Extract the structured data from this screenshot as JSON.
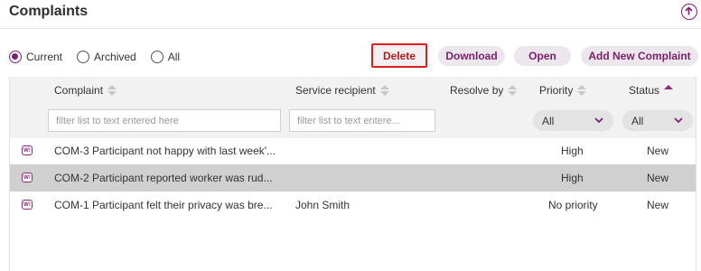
{
  "header": {
    "title": "Complaints",
    "upload_icon": "upload-icon"
  },
  "filters": {
    "radios": [
      {
        "label": "Current",
        "checked": true
      },
      {
        "label": "Archived",
        "checked": false
      },
      {
        "label": "All",
        "checked": false
      }
    ]
  },
  "actions": {
    "delete": "Delete",
    "download": "Download",
    "open": "Open",
    "add": "Add New Complaint"
  },
  "table": {
    "columns": {
      "complaint": "Complaint",
      "service_recipient": "Service recipient",
      "resolve_by": "Resolve by",
      "priority": "Priority",
      "status": "Status"
    },
    "filter_placeholders": {
      "complaint": "filter list to text entered here",
      "service_recipient": "filter list to text entere..."
    },
    "select_values": {
      "priority": "All",
      "status": "All"
    },
    "rows": [
      {
        "complaint": "COM-3 Participant not happy with last week'...",
        "service_recipient": "",
        "resolve_by": "",
        "priority": "High",
        "status": "New",
        "selected": false
      },
      {
        "complaint": "COM-2 Participant reported worker was rud...",
        "service_recipient": "",
        "resolve_by": "",
        "priority": "High",
        "status": "New",
        "selected": true
      },
      {
        "complaint": "COM-1 Participant felt their privacy was bre...",
        "service_recipient": "John Smith",
        "resolve_by": "",
        "priority": "No priority",
        "status": "New",
        "selected": false
      }
    ]
  },
  "colors": {
    "accent": "#7d1f6e",
    "delete_border": "#e11c1c",
    "selected_row": "#d0d0d0"
  }
}
